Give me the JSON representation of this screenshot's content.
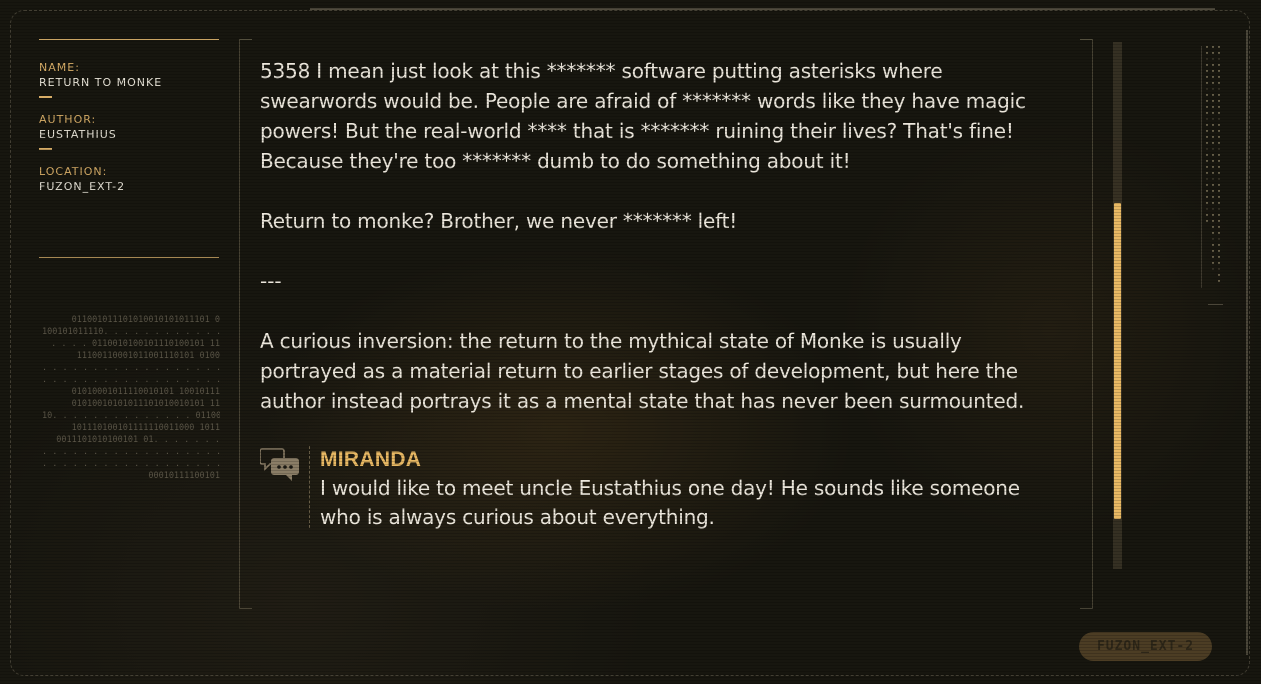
{
  "info": {
    "name_label": "NAME:",
    "name_value": "RETURN TO MONKE",
    "author_label": "AUTHOR:",
    "author_value": "EUSTATHIUS",
    "location_label": "LOCATION:",
    "location_value": "FUZON_EXT-2"
  },
  "binary_lines": [
    "011001011101010010101011101 0",
    "100101011110. . . . . . . . . . . . .",
    ". . . . 0110010100101110100101 11",
    "11100110001011001110101 0100",
    ". . . . . . . . . . . . . . . . . . . . . . . . .",
    ". . . . . . . . . . . . . . . . . . . . . . . 01",
    "01010001011110010101 10010111",
    "01010010101011101010010101 11",
    "10. . . . . . . . . . . . . . 0110010100",
    "101110100101111110011000 1011",
    "0011101010100101 01. . . . . . .",
    ". . . . . . . . . . . . . . . . . . . . . . . . .",
    ". . . . . . . . . . . . . . . . . . . . 010101",
    "00010111100101"
  ],
  "post": {
    "paragraphs": [
      "5358 I mean just look at this ******* software putting asterisks where swearwords would be. People are afraid of ******* words like they have magic powers! But the real-world **** that is ******* ruining their lives? That's fine! Because they're too ******* dumb to do something about it!",
      "Return to monke? Brother, we never ******* left!"
    ],
    "separator": "---",
    "analysis": "A curious inversion: the return to the mythical state of Monke is usually portrayed as a material return to earlier stages of development, but here the author instead portrays it as a mental state that has never been surmounted."
  },
  "comment": {
    "author": "MIRANDA",
    "text": "I would like to meet uncle Eustathius one day! He sounds like someone who is always curious about everything.",
    "icon": "chat-bubbles-icon"
  },
  "scroll": {
    "thumb_start_fraction": 0.305,
    "thumb_size_fraction": 0.6
  },
  "badge": {
    "label": "FUZON_EXT-2"
  },
  "colors": {
    "accent": "#e9b964",
    "label": "#d7ad67",
    "text": "#ece7dc",
    "background": "#17160f"
  }
}
